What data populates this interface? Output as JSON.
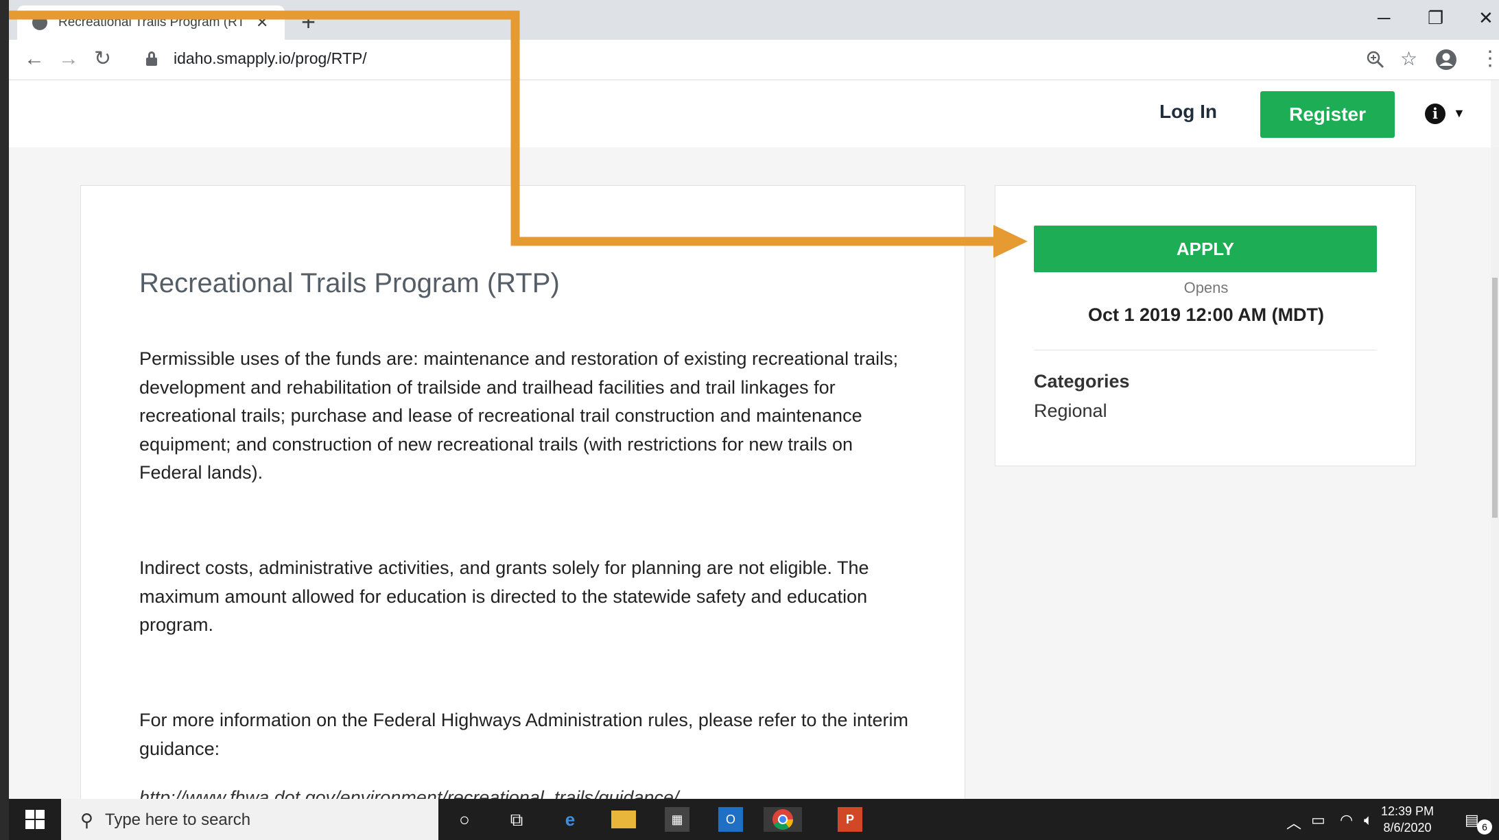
{
  "browser": {
    "tab_title": "Recreational Trails Program (RTP)",
    "tab_close": "✕",
    "new_tab": "+",
    "url": "idaho.smapply.io/prog/RTP/",
    "window_controls": [
      "─",
      "❐",
      "✕"
    ]
  },
  "header": {
    "login_label": "Log In",
    "register_label": "Register",
    "info_icon": "i"
  },
  "program": {
    "title": "Recreational Trails Program (RTP)",
    "paragraphs": [
      "Permissible uses of the funds are: maintenance and restoration of existing recreational trails; development and rehabilitation of trailside and trailhead facilities and trail linkages for recreational trails; purchase and lease of recreational trail construction and maintenance equipment; and construction of new recreational trails (with restrictions for new trails on Federal lands).",
      "Indirect costs, administrative activities, and grants solely for planning are not eligible. The maximum amount allowed for education is directed to the statewide safety and education program.",
      "For more information on the Federal Highways Administration rules, please refer to the interim guidance:",
      "http://www.fhwa.dot.gov/environment/recreational_trails/guidance/"
    ]
  },
  "sidebar": {
    "apply_label": "APPLY",
    "opens_label": "Opens",
    "opens_date": "Oct 1 2019 12:00 AM (MDT)",
    "categories_label": "Categories",
    "categories_value": "Regional"
  },
  "taskbar": {
    "search_placeholder": "Type here to search",
    "time": "12:39 PM",
    "date": "8/6/2020",
    "notification_count": "6"
  },
  "colors": {
    "brand_green": "#1dad55",
    "annotation_orange": "#e69b32"
  }
}
